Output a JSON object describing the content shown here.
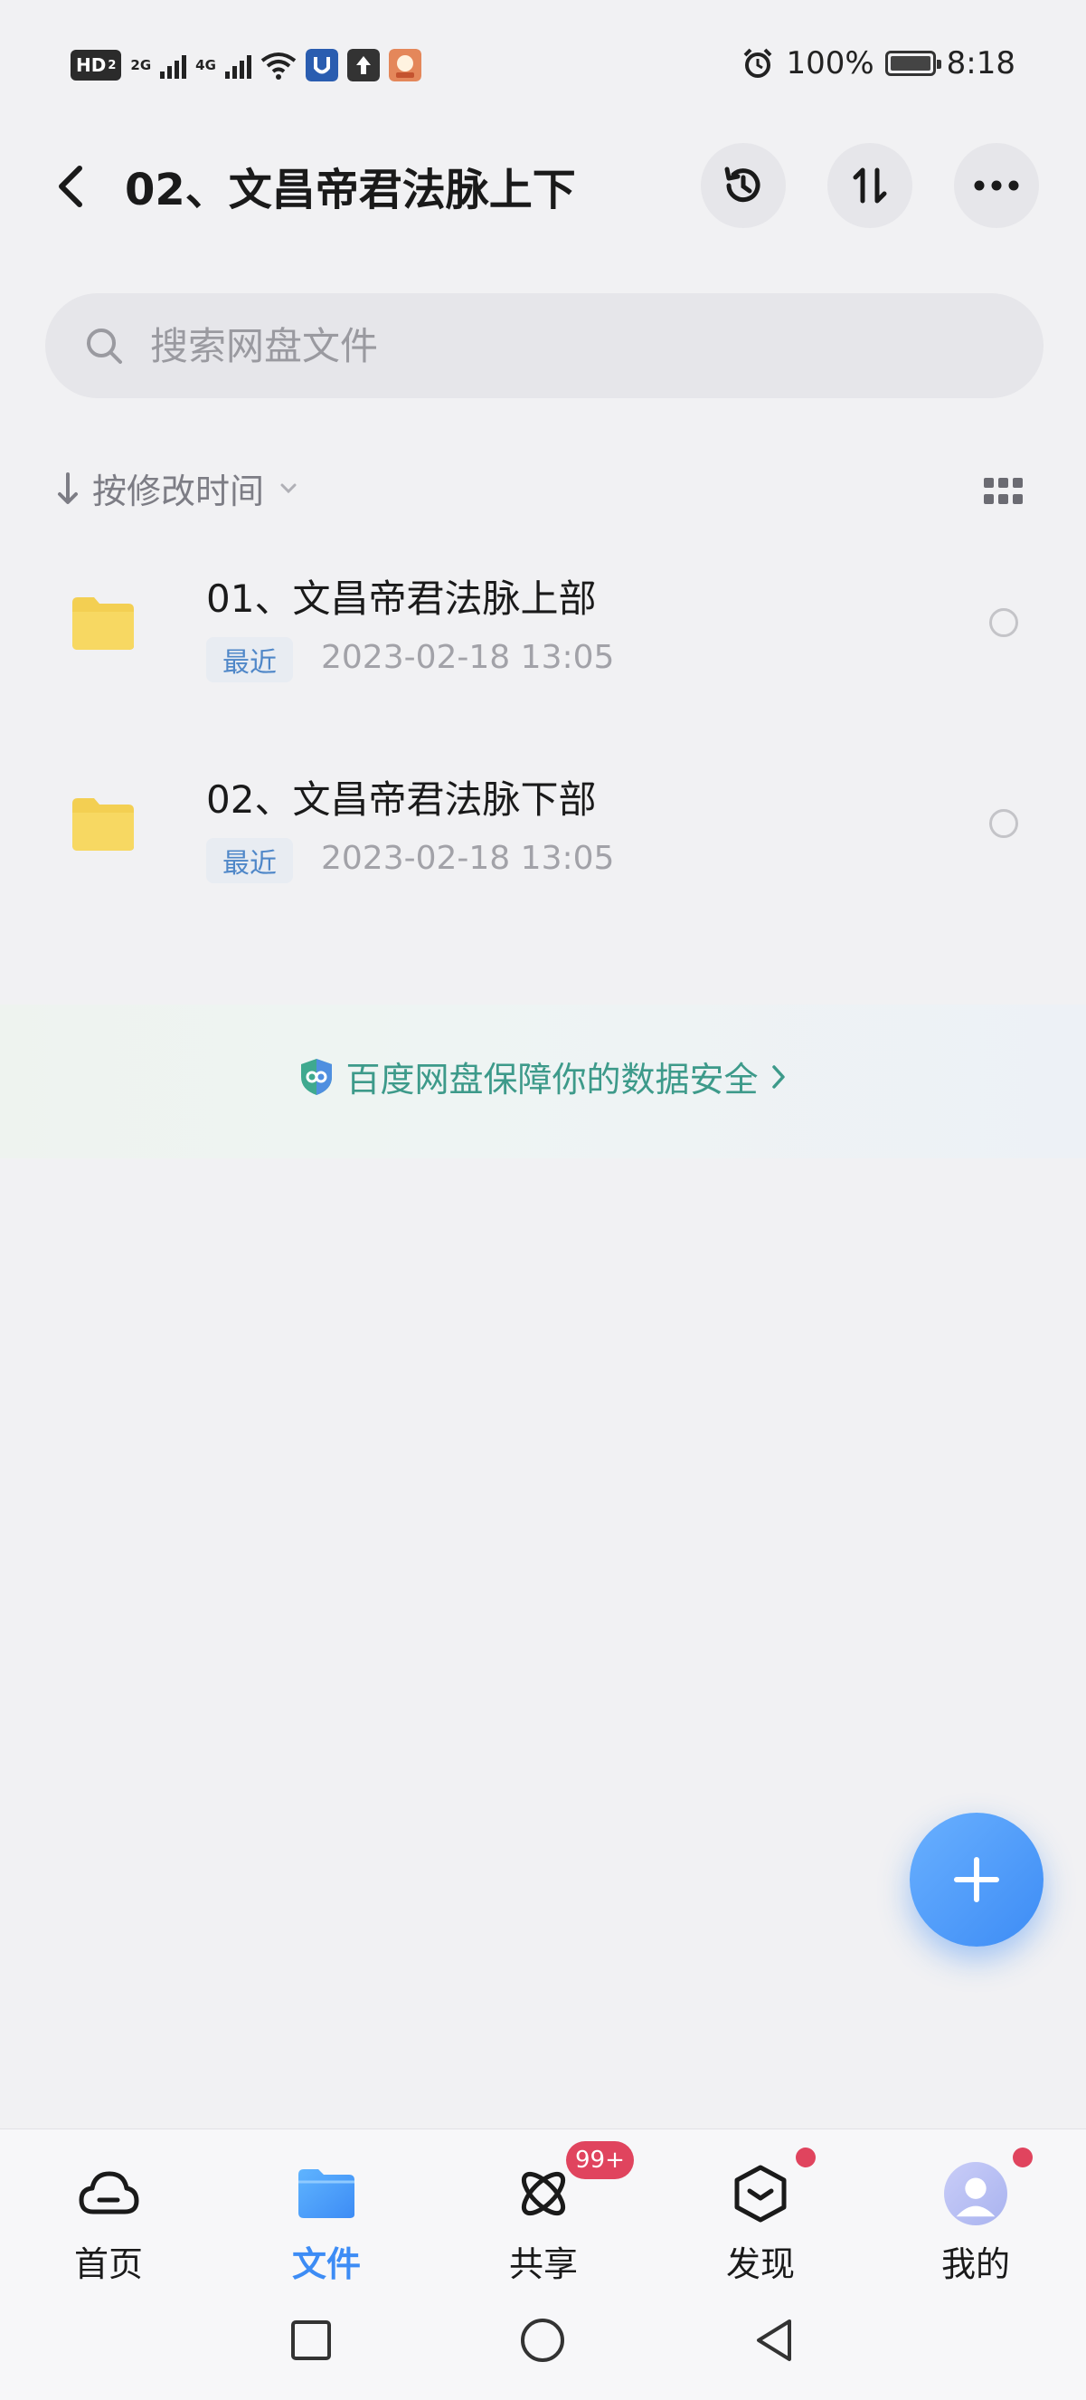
{
  "status_bar": {
    "hd_label": "HD",
    "hd_sub": "2",
    "sim1_label": "2G",
    "sim2_label": "4G",
    "battery_percent": "100%",
    "time": "8:18",
    "battery_level": 1.0
  },
  "header": {
    "title": "02、文昌帝君法脉上下"
  },
  "search": {
    "placeholder": "搜索网盘文件"
  },
  "sort": {
    "label": "按修改时间"
  },
  "files": [
    {
      "name": "01、文昌帝君法脉上部",
      "tag": "最近",
      "date": "2023-02-18  13:05"
    },
    {
      "name": "02、文昌帝君法脉下部",
      "tag": "最近",
      "date": "2023-02-18  13:05"
    }
  ],
  "banner": {
    "text": "百度网盘保障你的数据安全"
  },
  "bottom_nav": {
    "items": [
      {
        "label": "首页",
        "icon": "cloud-icon"
      },
      {
        "label": "文件",
        "icon": "folder-icon",
        "active": true
      },
      {
        "label": "共享",
        "icon": "atom-icon",
        "badge": "99+"
      },
      {
        "label": "发现",
        "icon": "cube-icon",
        "dot": true
      },
      {
        "label": "我的",
        "icon": "avatar-icon",
        "dot": true
      }
    ]
  },
  "colors": {
    "accent": "#3d8cf5",
    "folder": "#f3cf52",
    "badge": "#e0445e",
    "banner_text": "#3d9a8a"
  }
}
